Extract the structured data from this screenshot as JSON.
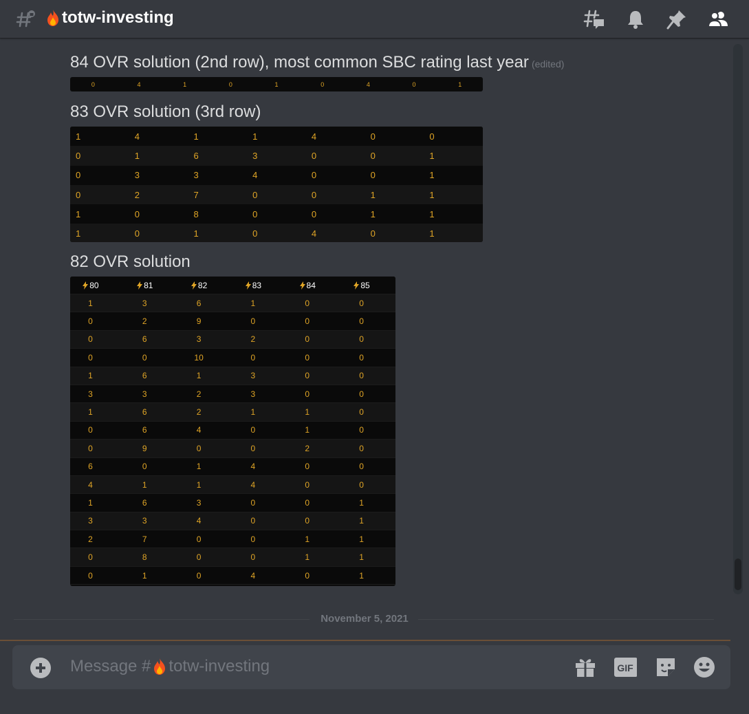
{
  "header": {
    "channel_name": "totw-investing",
    "icons": [
      "threads-icon",
      "bell-icon",
      "pin-icon",
      "members-icon"
    ]
  },
  "messages": [
    {
      "text": "84 OVR solution (2nd row), most common SBC rating last year",
      "edited_label": "(edited)"
    },
    {
      "text": "83 OVR solution (3rd row)"
    },
    {
      "text": "82 OVR solution"
    }
  ],
  "table_84": {
    "values": [
      "0",
      "4",
      "1",
      "0",
      "1",
      "0",
      "4",
      "0",
      "1"
    ]
  },
  "table_83": {
    "rows": [
      [
        "1",
        "4",
        "1",
        "1",
        "4",
        "0",
        "0"
      ],
      [
        "0",
        "1",
        "6",
        "3",
        "0",
        "0",
        "1"
      ],
      [
        "0",
        "3",
        "3",
        "4",
        "0",
        "0",
        "1"
      ],
      [
        "0",
        "2",
        "7",
        "0",
        "0",
        "1",
        "1"
      ],
      [
        "1",
        "0",
        "8",
        "0",
        "0",
        "1",
        "1"
      ],
      [
        "1",
        "0",
        "1",
        "0",
        "4",
        "0",
        "1"
      ]
    ]
  },
  "table_82": {
    "headers": [
      "80",
      "81",
      "82",
      "83",
      "84",
      "85"
    ],
    "rows": [
      [
        "1",
        "3",
        "6",
        "1",
        "0",
        "0"
      ],
      [
        "0",
        "2",
        "9",
        "0",
        "0",
        "0"
      ],
      [
        "0",
        "6",
        "3",
        "2",
        "0",
        "0"
      ],
      [
        "0",
        "0",
        "10",
        "0",
        "0",
        "0"
      ],
      [
        "1",
        "6",
        "1",
        "3",
        "0",
        "0"
      ],
      [
        "3",
        "3",
        "2",
        "3",
        "0",
        "0"
      ],
      [
        "1",
        "6",
        "2",
        "1",
        "1",
        "0"
      ],
      [
        "0",
        "6",
        "4",
        "0",
        "1",
        "0"
      ],
      [
        "0",
        "9",
        "0",
        "0",
        "2",
        "0"
      ],
      [
        "6",
        "0",
        "1",
        "4",
        "0",
        "0"
      ],
      [
        "4",
        "1",
        "1",
        "4",
        "0",
        "0"
      ],
      [
        "1",
        "6",
        "3",
        "0",
        "0",
        "1"
      ],
      [
        "3",
        "3",
        "4",
        "0",
        "0",
        "1"
      ],
      [
        "2",
        "7",
        "0",
        "0",
        "1",
        "1"
      ],
      [
        "0",
        "8",
        "0",
        "0",
        "1",
        "1"
      ],
      [
        "0",
        "1",
        "0",
        "4",
        "0",
        "1"
      ]
    ]
  },
  "divider": {
    "date": "November 5, 2021"
  },
  "composer": {
    "placeholder_prefix": "Message #",
    "placeholder_channel": "totw-investing",
    "gif_label": "GIF",
    "icons": [
      "plus-icon",
      "gift-icon",
      "gif-icon",
      "sticker-icon",
      "emoji-icon"
    ]
  },
  "colors": {
    "background": "#36393f",
    "composer": "#40444b",
    "table_text": "#e0a526",
    "muted": "#72767d"
  }
}
